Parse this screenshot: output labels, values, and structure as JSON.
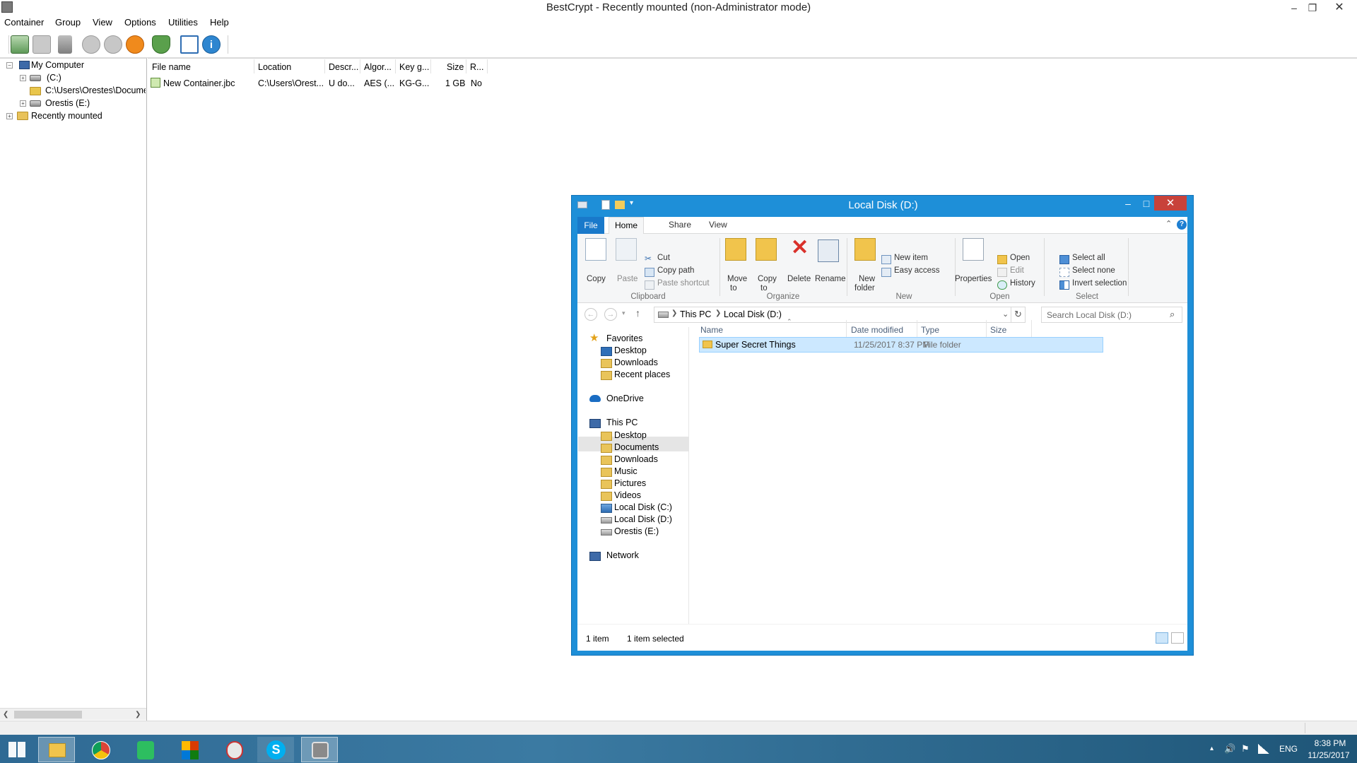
{
  "bestcrypt": {
    "title": "BestCrypt - Recently mounted (non-Administrator mode)",
    "menu": [
      "Container",
      "Group",
      "View",
      "Options",
      "Utilities",
      "Help"
    ],
    "tree": {
      "my_computer": "My Computer",
      "drive_c": "(C:)",
      "container_path": "C:\\Users\\Orestes\\Docume",
      "drive_e": "Orestis (E:)",
      "recently_mounted": "Recently mounted"
    },
    "columns": [
      "File name",
      "Location",
      "Descr...",
      "Algor...",
      "Key g...",
      "Size",
      "R..."
    ],
    "rows": [
      [
        "New Container.jbc",
        "C:\\Users\\Orest...",
        "U do...",
        "AES (...",
        "KG-G...",
        "1 GB",
        "No"
      ]
    ]
  },
  "explorer": {
    "title": "Local Disk (D:)",
    "tabs": {
      "file": "File",
      "home": "Home",
      "share": "Share",
      "view": "View"
    },
    "ribbon": {
      "copy": "Copy",
      "paste": "Paste",
      "cut": "Cut",
      "copy_path": "Copy path",
      "paste_shortcut": "Paste shortcut",
      "clipboard": "Clipboard",
      "move_to_1": "Move",
      "move_to_2": "to",
      "copy_to_1": "Copy",
      "copy_to_2": "to",
      "delete": "Delete",
      "rename": "Rename",
      "organize": "Organize",
      "new_folder_1": "New",
      "new_folder_2": "folder",
      "new_item": "New item",
      "easy_access": "Easy access",
      "new": "New",
      "properties": "Properties",
      "open_btn": "Open",
      "edit": "Edit",
      "history": "History",
      "open": "Open",
      "select_all": "Select all",
      "select_none": "Select none",
      "invert_selection": "Invert selection",
      "select": "Select"
    },
    "address": {
      "crumb1": "This PC",
      "crumb2": "Local Disk (D:)",
      "search_placeholder": "Search Local Disk (D:)"
    },
    "nav": {
      "favorites": "Favorites",
      "desktop": "Desktop",
      "downloads": "Downloads",
      "recent": "Recent places",
      "onedrive": "OneDrive",
      "this_pc": "This PC",
      "pc_desktop": "Desktop",
      "documents": "Documents",
      "pc_downloads": "Downloads",
      "music": "Music",
      "pictures": "Pictures",
      "videos": "Videos",
      "disk_c": "Local Disk (C:)",
      "disk_d": "Local Disk (D:)",
      "orestis_e": "Orestis (E:)",
      "network": "Network"
    },
    "columns": {
      "name": "Name",
      "date": "Date modified",
      "type": "Type",
      "size": "Size"
    },
    "files": [
      {
        "name": "Super Secret Things",
        "date": "11/25/2017 8:37 PM",
        "type": "File folder",
        "size": ""
      }
    ],
    "status": {
      "count": "1 item",
      "selected": "1 item selected"
    }
  },
  "taskbar": {
    "lang": "ENG",
    "time": "8:38 PM",
    "date": "11/25/2017"
  },
  "colors": {
    "explorer_frame": "#1e8fd8",
    "close_red": "#c8423a",
    "selection": "#cce8ff",
    "taskbar": "#2f6a94"
  }
}
